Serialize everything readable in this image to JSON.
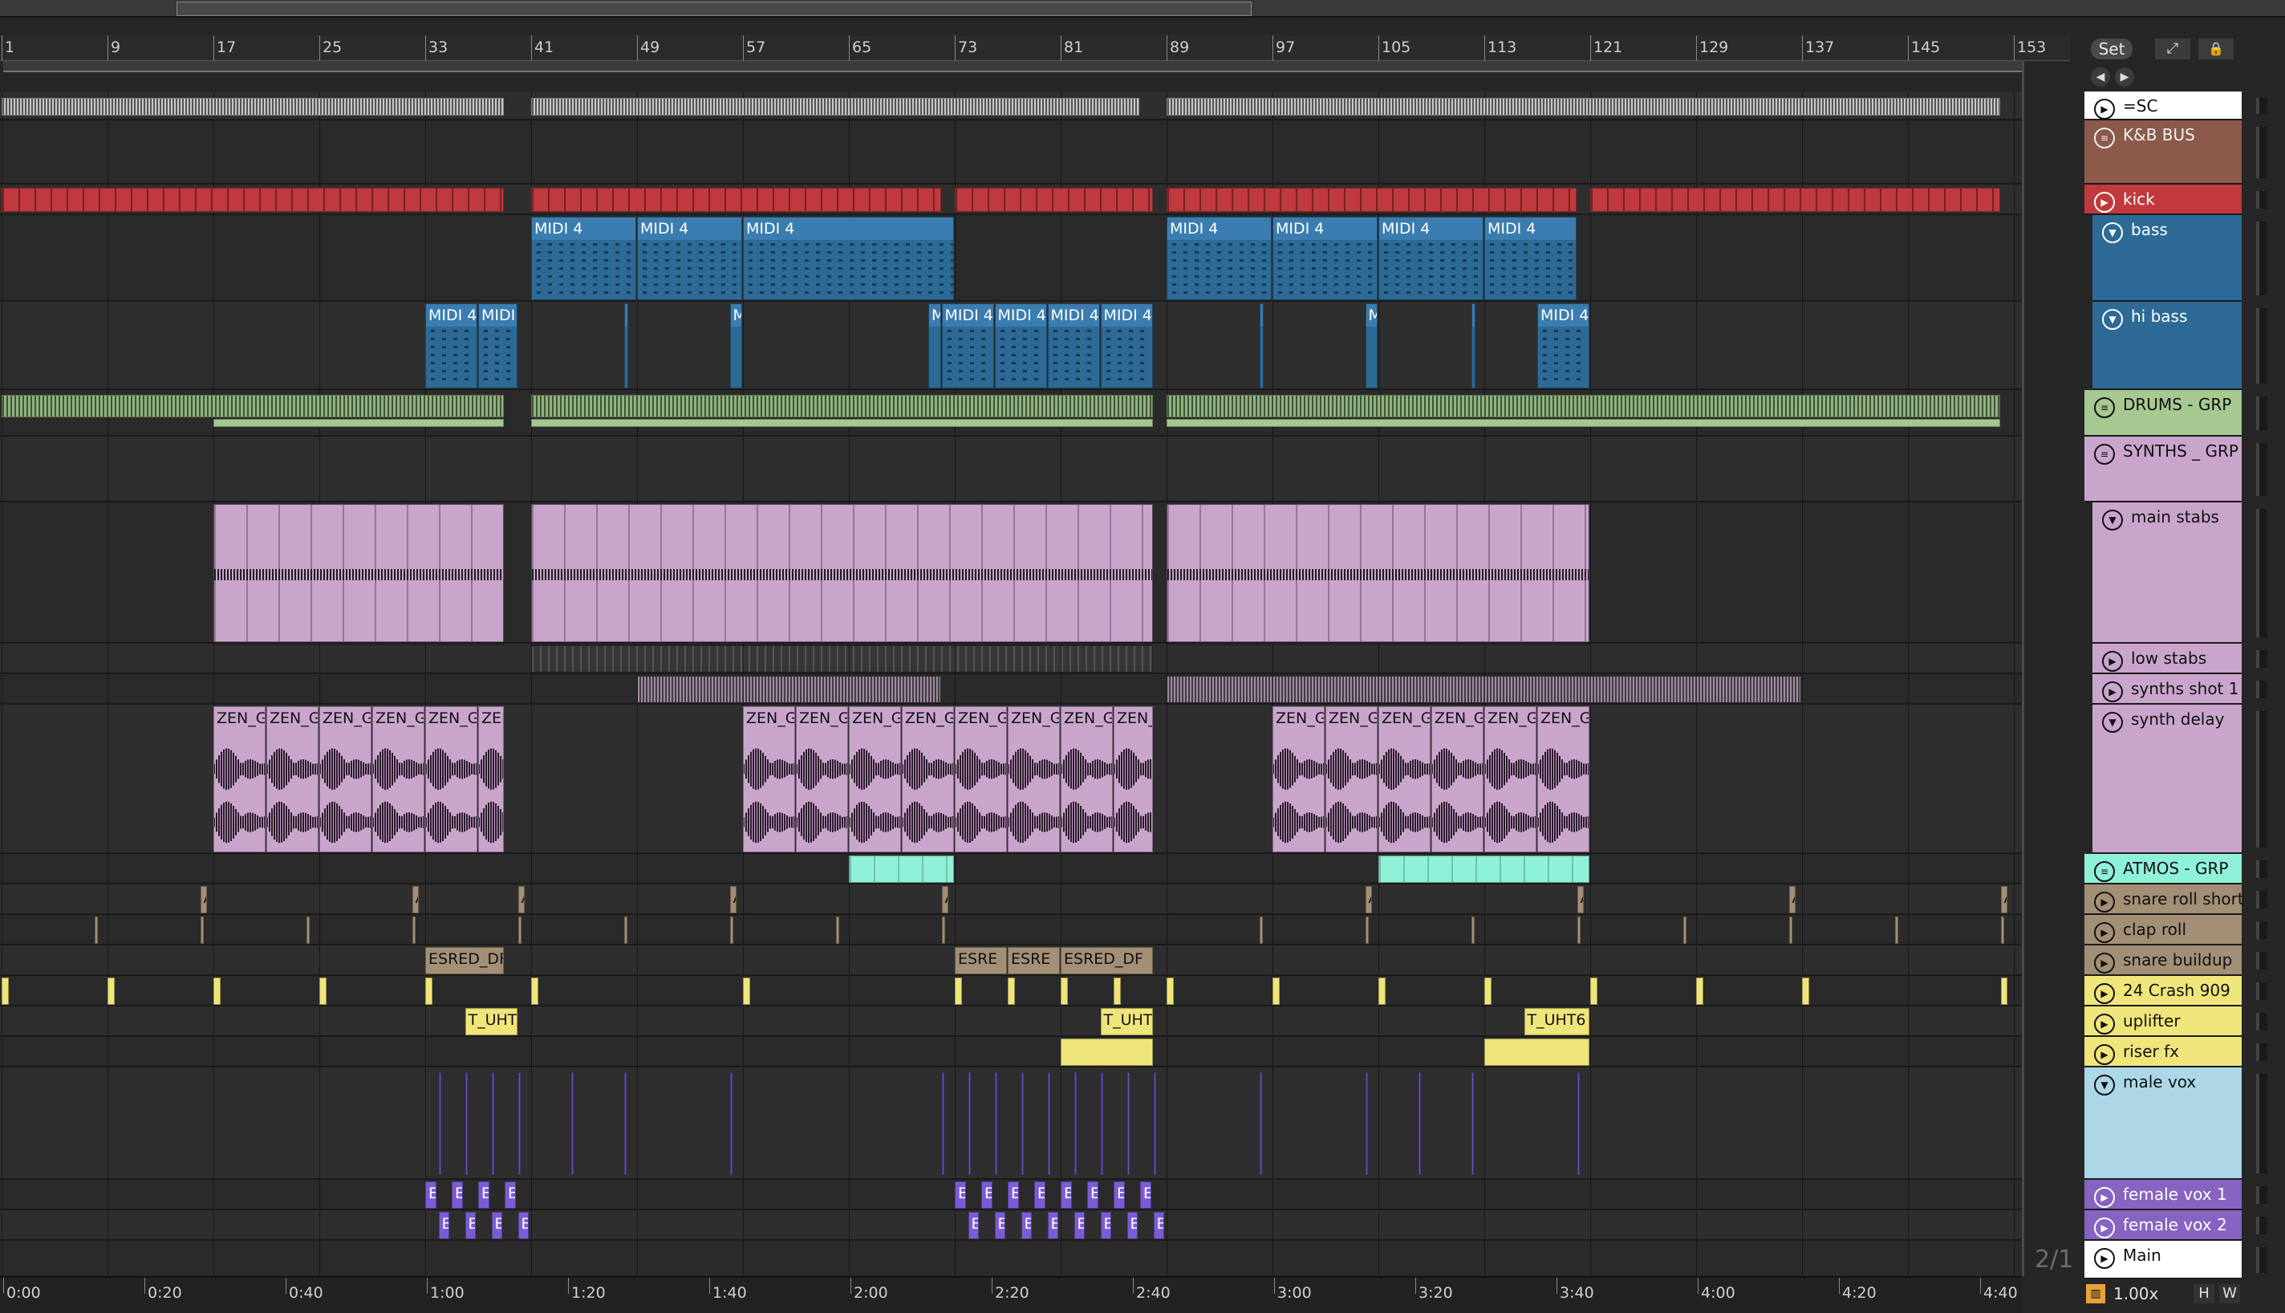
{
  "toolbar": {
    "set_label": "Set",
    "expand_icon": "expand-icon",
    "lock_icon": "lock-icon"
  },
  "bar_ruler": [
    "1",
    "9",
    "17",
    "25",
    "33",
    "41",
    "49",
    "57",
    "65",
    "73",
    "81",
    "89",
    "97",
    "105",
    "113",
    "121",
    "129",
    "137",
    "145",
    "153"
  ],
  "time_ruler": [
    "0:00",
    "0:20",
    "0:40",
    "1:00",
    "1:20",
    "1:40",
    "2:00",
    "2:20",
    "2:40",
    "3:00",
    "3:20",
    "3:40",
    "4:00",
    "4:20",
    "4:40"
  ],
  "tracks": [
    {
      "name": "=SC",
      "color": "#ffffff",
      "text": "#111111"
    },
    {
      "name": "K&B BUS",
      "color": "#8b5a4a",
      "text": "#f0f0f0"
    },
    {
      "name": "kick",
      "color": "#c0393d",
      "text": "#ffffff"
    },
    {
      "name": "bass",
      "color": "#2d6a96",
      "text": "#ffffff"
    },
    {
      "name": "hi bass",
      "color": "#2d6a96",
      "text": "#ffffff"
    },
    {
      "name": "DRUMS - GRP",
      "color": "#a6c891",
      "text": "#111111"
    },
    {
      "name": "SYNTHS _ GRP",
      "color": "#c9a5cc",
      "text": "#111111"
    },
    {
      "name": "main stabs",
      "color": "#c9a5cc",
      "text": "#111111"
    },
    {
      "name": "low stabs",
      "color": "#c9a5cc",
      "text": "#111111"
    },
    {
      "name": "synths shot 1",
      "color": "#c9a5cc",
      "text": "#111111"
    },
    {
      "name": "synth delay",
      "color": "#c9a5cc",
      "text": "#111111"
    },
    {
      "name": "ATMOS - GRP",
      "color": "#8ff1d8",
      "text": "#111111"
    },
    {
      "name": "snare roll short",
      "color": "#a38f76",
      "text": "#111111"
    },
    {
      "name": "clap roll",
      "color": "#a38f76",
      "text": "#111111"
    },
    {
      "name": "snare buildup",
      "color": "#a38f76",
      "text": "#111111"
    },
    {
      "name": "24 Crash 909",
      "color": "#f0e57a",
      "text": "#111111"
    },
    {
      "name": "uplifter",
      "color": "#f0e57a",
      "text": "#111111"
    },
    {
      "name": "riser fx",
      "color": "#f0e57a",
      "text": "#111111"
    },
    {
      "name": "male vox",
      "color": "#abd7e6",
      "text": "#111111"
    },
    {
      "name": "female vox 1",
      "color": "#8763c2",
      "text": "#ffffff"
    },
    {
      "name": "female vox 2",
      "color": "#8763c2",
      "text": "#ffffff"
    },
    {
      "name": "Main",
      "color": "#ffffff",
      "text": "#111111"
    }
  ],
  "clip_labels": {
    "midi": "MIDI 4",
    "midi_short": "MIDI",
    "midi_letter": "M",
    "zen": "ZEN_G",
    "esred": "ESRED_DF",
    "esred_short": "ESRE",
    "uht": "T_UHT",
    "uht6": "T_UHT6",
    "a_marker": "A",
    "e_marker": "E"
  },
  "footer": {
    "zoom": "1.00x",
    "h_label": "H",
    "w_label": "W",
    "time_sig": "2/1"
  }
}
